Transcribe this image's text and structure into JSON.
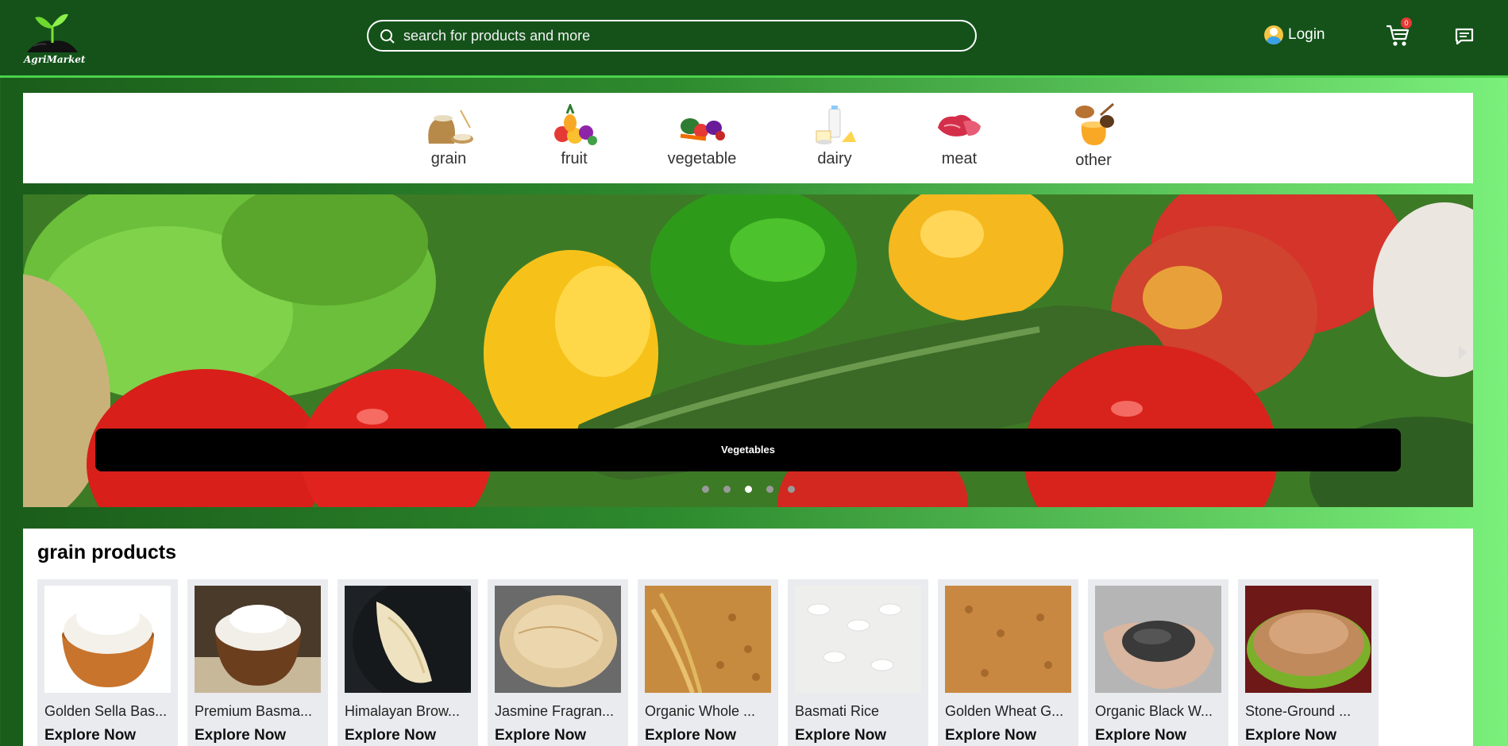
{
  "header": {
    "logo_text": "AgriMarket",
    "search_placeholder": "search for products and more",
    "login_label": "Login",
    "cart_count": "0",
    "icons": [
      "search-icon",
      "avatar-icon",
      "cart-icon",
      "chat-icon"
    ]
  },
  "categories": [
    {
      "label": "grain"
    },
    {
      "label": "fruit"
    },
    {
      "label": "vegetable"
    },
    {
      "label": "dairy"
    },
    {
      "label": "meat"
    },
    {
      "label": "other"
    }
  ],
  "carousel": {
    "caption": "Vegetables",
    "slide_count": 5,
    "active_index": 2
  },
  "products": {
    "title": "grain products",
    "items": [
      {
        "name": "Golden Sella Bas...",
        "action": "Explore Now"
      },
      {
        "name": "Premium Basma...",
        "action": "Explore Now"
      },
      {
        "name": "Himalayan Brow...",
        "action": "Explore Now"
      },
      {
        "name": "Jasmine Fragran...",
        "action": "Explore Now"
      },
      {
        "name": "Organic Whole ...",
        "action": "Explore Now"
      },
      {
        "name": "Basmati Rice",
        "action": "Explore Now"
      },
      {
        "name": "Golden Wheat G...",
        "action": "Explore Now"
      },
      {
        "name": "Organic Black W...",
        "action": "Explore Now"
      },
      {
        "name": "Stone-Ground ...",
        "action": "Explore Now"
      }
    ]
  },
  "colors": {
    "header_bg": "#14521a",
    "accent": "#4cd24c",
    "badge": "#e53935"
  }
}
